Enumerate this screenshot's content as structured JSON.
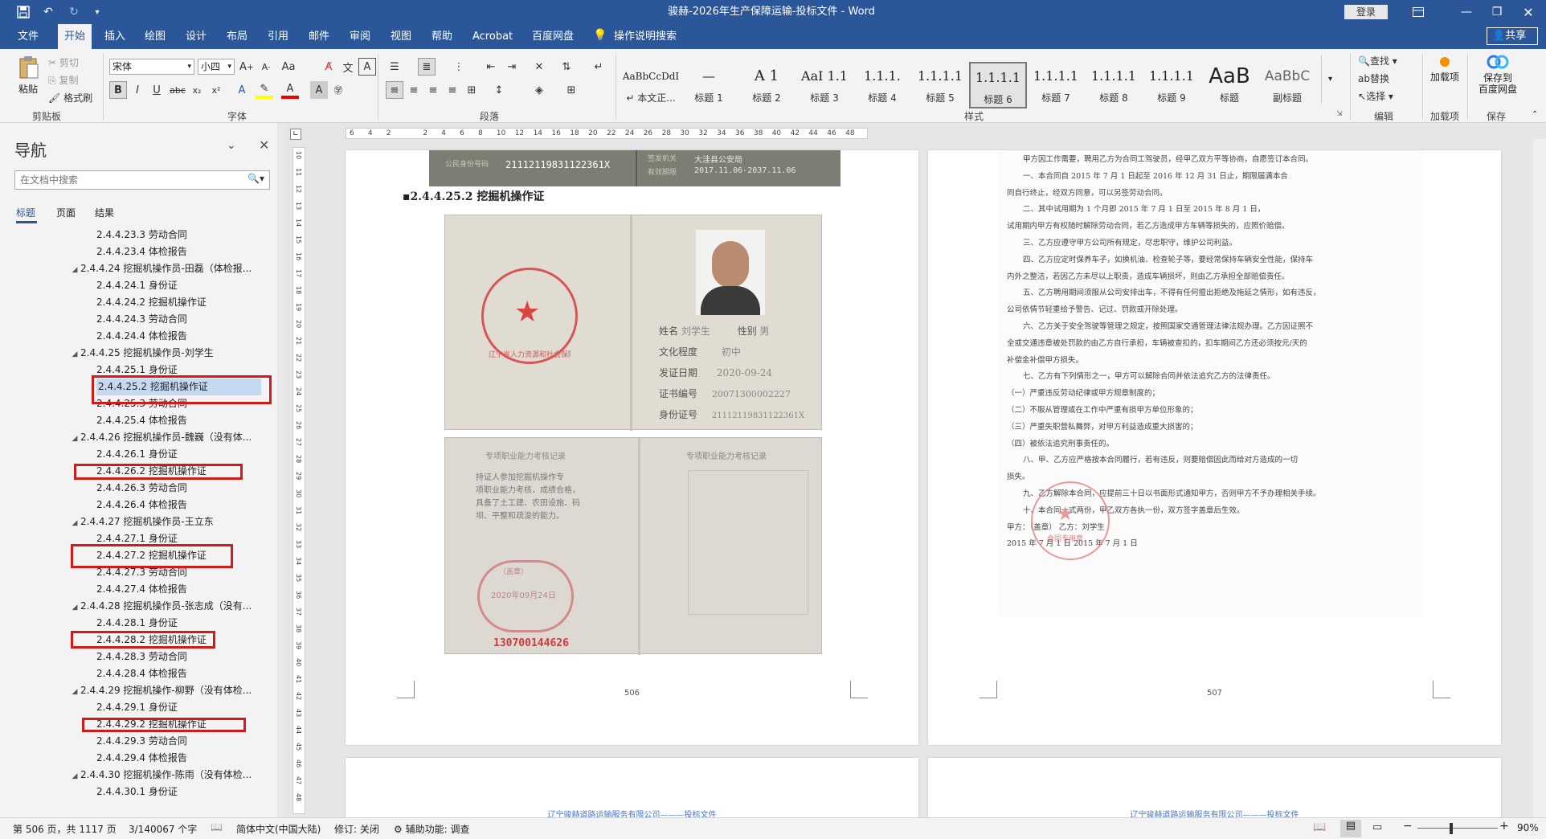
{
  "titlebar": {
    "title": "骏赫-2026年生产保障运输-投标文件 - Word",
    "login": "登录",
    "icons": [
      "save-icon",
      "undo-icon",
      "redo-icon",
      "customize-icon",
      "ribbon-display-icon",
      "minimize-icon",
      "restore-icon",
      "close-icon"
    ]
  },
  "tabs": [
    "文件",
    "开始",
    "插入",
    "绘图",
    "设计",
    "布局",
    "引用",
    "邮件",
    "审阅",
    "视图",
    "帮助",
    "Acrobat",
    "百度网盘"
  ],
  "active_tab": "开始",
  "tell_me": "操作说明搜索",
  "share": "共享",
  "clipboard": {
    "paste": "粘贴",
    "cut": "剪切",
    "copy": "复制",
    "format_painter": "格式刷",
    "label": "剪贴板"
  },
  "font": {
    "name": "宋体",
    "size": "小四",
    "label": "字体"
  },
  "paragraph": {
    "label": "段落"
  },
  "styles": {
    "label": "样式",
    "items": [
      {
        "sample": "AaBbCcDdI",
        "name": "↵ 本文正..."
      },
      {
        "sample": "—",
        "name": "标题 1"
      },
      {
        "sample": "A 1",
        "name": "标题 2"
      },
      {
        "sample": "AaI 1.1",
        "name": "标题 3"
      },
      {
        "sample": "1.1.1.",
        "name": "标题 4"
      },
      {
        "sample": "1.1.1.1",
        "name": "标题 5"
      },
      {
        "sample": "1.1.1.1",
        "name": "标题 6"
      },
      {
        "sample": "1.1.1.1",
        "name": "标题 7"
      },
      {
        "sample": "1.1.1.1",
        "name": "标题 8"
      },
      {
        "sample": "1.1.1.1",
        "name": "标题 9"
      },
      {
        "sample": "AaB",
        "name": "标题"
      },
      {
        "sample": "AaBbC",
        "name": "副标题"
      }
    ]
  },
  "editing": {
    "find": "查找",
    "replace": "替换",
    "select": "选择",
    "label": "编辑"
  },
  "addins": {
    "load": "加载项",
    "label": "加载项",
    "baidu_line1": "保存到",
    "baidu_line2": "百度网盘",
    "save_label": "保存"
  },
  "nav": {
    "title": "导航",
    "search_placeholder": "在文档中搜索",
    "tabs": [
      "标题",
      "页面",
      "结果"
    ],
    "items": [
      {
        "level": 2,
        "text": "2.4.4.23.3 劳动合同"
      },
      {
        "level": 2,
        "text": "2.4.4.23.4 体检报告"
      },
      {
        "level": 1,
        "text": "2.4.4.24 挖掘机操作员-田磊（体检报..."
      },
      {
        "level": 2,
        "text": "2.4.4.24.1 身份证"
      },
      {
        "level": 2,
        "text": "2.4.4.24.2 挖掘机操作证"
      },
      {
        "level": 2,
        "text": "2.4.4.24.3 劳动合同"
      },
      {
        "level": 2,
        "text": "2.4.4.24.4 体检报告"
      },
      {
        "level": 1,
        "text": "2.4.4.25 挖掘机操作员-刘学生"
      },
      {
        "level": 2,
        "text": "2.4.4.25.1 身份证"
      },
      {
        "level": 2,
        "text": "2.4.4.25.2 挖掘机操作证",
        "selected": true
      },
      {
        "level": 2,
        "text": "2.4.4.25.3 劳动合同"
      },
      {
        "level": 2,
        "text": "2.4.4.25.4 体检报告"
      },
      {
        "level": 1,
        "text": "2.4.4.26 挖掘机操作员-魏巍（没有体..."
      },
      {
        "level": 2,
        "text": "2.4.4.26.1 身份证"
      },
      {
        "level": 2,
        "text": "2.4.4.26.2 挖掘机操作证"
      },
      {
        "level": 2,
        "text": "2.4.4.26.3 劳动合同"
      },
      {
        "level": 2,
        "text": "2.4.4.26.4 体检报告"
      },
      {
        "level": 1,
        "text": "2.4.4.27 挖掘机操作员-王立东"
      },
      {
        "level": 2,
        "text": "2.4.4.27.1 身份证"
      },
      {
        "level": 2,
        "text": "2.4.4.27.2 挖掘机操作证"
      },
      {
        "level": 2,
        "text": "2.4.4.27.3 劳动合同"
      },
      {
        "level": 2,
        "text": "2.4.4.27.4 体检报告"
      },
      {
        "level": 1,
        "text": "2.4.4.28 挖掘机操作员-张志成（没有..."
      },
      {
        "level": 2,
        "text": "2.4.4.28.1 身份证"
      },
      {
        "level": 2,
        "text": "2.4.4.28.2 挖掘机操作证"
      },
      {
        "level": 2,
        "text": "2.4.4.28.3 劳动合同"
      },
      {
        "level": 2,
        "text": "2.4.4.28.4 体检报告"
      },
      {
        "level": 1,
        "text": "2.4.4.29 挖掘机操作-柳野（没有体检..."
      },
      {
        "level": 2,
        "text": "2.4.4.29.1 身份证"
      },
      {
        "level": 2,
        "text": "2.4.4.29.2 挖掘机操作证"
      },
      {
        "level": 2,
        "text": "2.4.4.29.3 劳动合同"
      },
      {
        "level": 2,
        "text": "2.4.4.29.4 体检报告"
      },
      {
        "level": 1,
        "text": "2.4.4.30 挖掘机操作-陈雨（没有体检..."
      },
      {
        "level": 2,
        "text": "2.4.4.30.1 身份证"
      }
    ]
  },
  "ruler_h": [
    "6",
    "4",
    "2",
    "",
    "2",
    "4",
    "6",
    "8",
    "10",
    "12",
    "14",
    "16",
    "18",
    "20",
    "22",
    "24",
    "26",
    "28",
    "30",
    "32",
    "34",
    "36",
    "38",
    "40",
    "42",
    "44",
    "46",
    "48"
  ],
  "ruler_v": [
    "10",
    "11",
    "12",
    "13",
    "14",
    "15",
    "16",
    "17",
    "18",
    "19",
    "20",
    "21",
    "22",
    "23",
    "24",
    "25",
    "26",
    "27",
    "28",
    "29",
    "30",
    "31",
    "32",
    "33",
    "34",
    "35",
    "36",
    "37",
    "38",
    "39",
    "40",
    "41",
    "42",
    "43",
    "44",
    "45",
    "46",
    "47",
    "48"
  ],
  "page506": {
    "id_strip": {
      "label1": "公民身份号码",
      "number": "21112119831122361X",
      "label2": "签发机关",
      "issuer": "大洼县公安局",
      "label3": "有效期限",
      "validity": "2017.11.06-2037.11.06"
    },
    "heading": "2.4.4.25.2 挖掘机操作证",
    "cert": {
      "seal": "辽宁省人力资源和社会保障厅",
      "name_label": "姓名",
      "name": "刘学生",
      "sex_label": "性别",
      "sex": "男",
      "edu_label": "文化程度",
      "edu": "初中",
      "date_label": "发证日期",
      "date": "2020-09-24",
      "certno_label": "证书编号",
      "certno": "20071300002227",
      "idno_label": "身份证号",
      "idno": "21112119831122361X"
    },
    "record": {
      "title_left": "专项职业能力考核记录",
      "title_right": "专项职业能力考核记录",
      "line1": "持证人参加挖掘机操作专",
      "line2": "项职业能力考核，成绩合格，",
      "line3": "具备了土工建、农田设施、码",
      "line4": "坝、平整和疏浚的能力。",
      "stamp_org": "（盖章）",
      "stamp_date": "2020年09月24日",
      "red_number": "130700144626"
    },
    "page_number": "506"
  },
  "page507": {
    "lines": [
      "甲方因工作需要，聘用乙方为合同工驾驶员，经甲乙双方平等协商，自愿签订本合同。",
      "一、本合同自 2015 年 7 月 1 日起至 2016 年 12 月 31 日止，期限届满本合",
      "同自行终止，经双方同意，可以另签劳动合同。",
      "二、其中试用期为 1 个月即 2015 年 7 月 1 日至 2015 年 8 月 1 日，",
      "试用期内甲方有权随时解除劳动合同，若乙方造成甲方车辆等损失的，应照价赔偿。",
      "三、乙方应遵守甲方公司所有规定，尽忠职守，维护公司利益。",
      "四、乙方应定时保养车子，如换机油、检查轮子等，要经常保持车辆安全性能，保持车",
      "内外之整洁，若因乙方未尽以上职责，造成车辆损坏，则由乙方承担全部赔偿责任。",
      "五、乙方聘用期间须服从公司安排出车，不得有任何擅出拒绝及拖延之情形，如有违反，",
      "公司依情节轻重给予警告、记过、罚款或开除处理。",
      "六、乙方关于安全驾驶等管理之规定，按照国家交通管理法律法规办理。乙方因证照不",
      "全或交通违章被处罚款的由乙方自行承担，车辆被查扣的，扣车期间乙方还必须按元/天的",
      "补偿金补偿甲方损失。",
      "七、乙方有下列情形之一，甲方可以解除合同并依法追究乙方的法律责任。",
      "（一）严重违反劳动纪律或甲方规章制度的；",
      "（二）不服从管理或在工作中严重有损甲方单位形象的；",
      "（三）严重失职营私舞弊，对甲方利益造成重大损害的；",
      "（四）被依法追究刑事责任的。",
      "八、甲、乙方应严格按本合同履行，若有违反，则要赔偿因此而给对方造成的一切",
      "损失。",
      "九、乙方解除本合同，应提前三十日以书面形式通知甲方，否则甲方不予办理相关手续。",
      "十、本合同一式两份，甲乙双方各执一份，双方签字盖章后生效。",
      "甲方：（盖章）                          乙方：刘学生",
      "2015 年 7 月 1 日                2015 年 7 月 1 日"
    ],
    "stamp": "合同专用章",
    "page_number": "507"
  },
  "footer_next": "辽宁骏赫道路运输服务有限公司———投标文件",
  "status": {
    "page": "第 506 页，共 1117 页",
    "words": "3/140067 个字",
    "language": "简体中文(中国大陆)",
    "track": "修订: 关闭",
    "accessibility": "辅助功能: 调查",
    "zoom": "90%"
  }
}
